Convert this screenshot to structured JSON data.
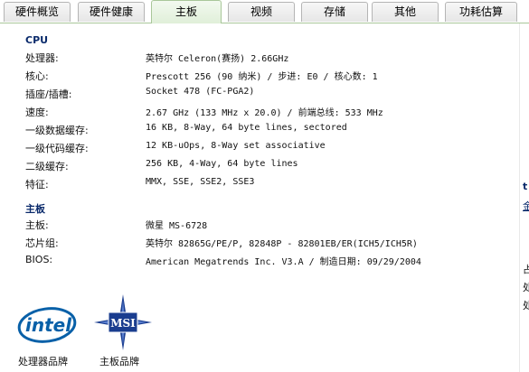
{
  "tabs": [
    {
      "label": "硬件概览"
    },
    {
      "label": "硬件健康"
    },
    {
      "label": "主板"
    },
    {
      "label": "视频"
    },
    {
      "label": "存储"
    },
    {
      "label": "其他"
    },
    {
      "label": "功耗估算"
    }
  ],
  "active_tab": "主板",
  "cpu": {
    "title": "CPU",
    "rows": [
      {
        "label": "处理器:",
        "value": "英特尔 Celeron(赛扬) 2.66GHz"
      },
      {
        "label": "核心:",
        "value": "Prescott 256 (90 纳米) / 步进: E0 / 核心数: 1"
      },
      {
        "label": "插座/插槽:",
        "value": "Socket 478 (FC-PGA2)"
      },
      {
        "label": "速度:",
        "value": "2.67 GHz (133 MHz x 20.0) / 前端总线: 533 MHz"
      },
      {
        "label": "一级数据缓存:",
        "value": "16 KB, 8-Way, 64 byte lines, sectored"
      },
      {
        "label": "一级代码缓存:",
        "value": "12 KB-uOps, 8-Way set associative"
      },
      {
        "label": "二级缓存:",
        "value": "256 KB, 4-Way, 64 byte lines"
      },
      {
        "label": "特征:",
        "value": "MMX, SSE, SSE2, SSE3"
      }
    ]
  },
  "mainboard": {
    "title": "主板",
    "rows": [
      {
        "label": "主板:",
        "value": "微星 MS-6728"
      },
      {
        "label": "芯片组:",
        "value": "英特尔 82865G/PE/P, 82848P - 82801EB/ER(ICH5/ICH5R)"
      },
      {
        "label": "BIOS:",
        "value": "American Megatrends Inc. V3.A  /  制造日期: 09/29/2004"
      }
    ]
  },
  "logos": {
    "cpu_brand_caption": "处理器品牌",
    "board_brand_caption": "主板品牌",
    "intel_text": "intel",
    "msi_text": "MSI"
  },
  "edge_glyphs": [
    "t",
    "金",
    "占",
    "处",
    "处"
  ],
  "colors": {
    "tab_active_bg": "#e0efd9",
    "tab_border": "#a9c79a",
    "section_title": "#0a2a6b",
    "intel_blue": "#0860a8",
    "msi_blue": "#1a3d8f"
  }
}
